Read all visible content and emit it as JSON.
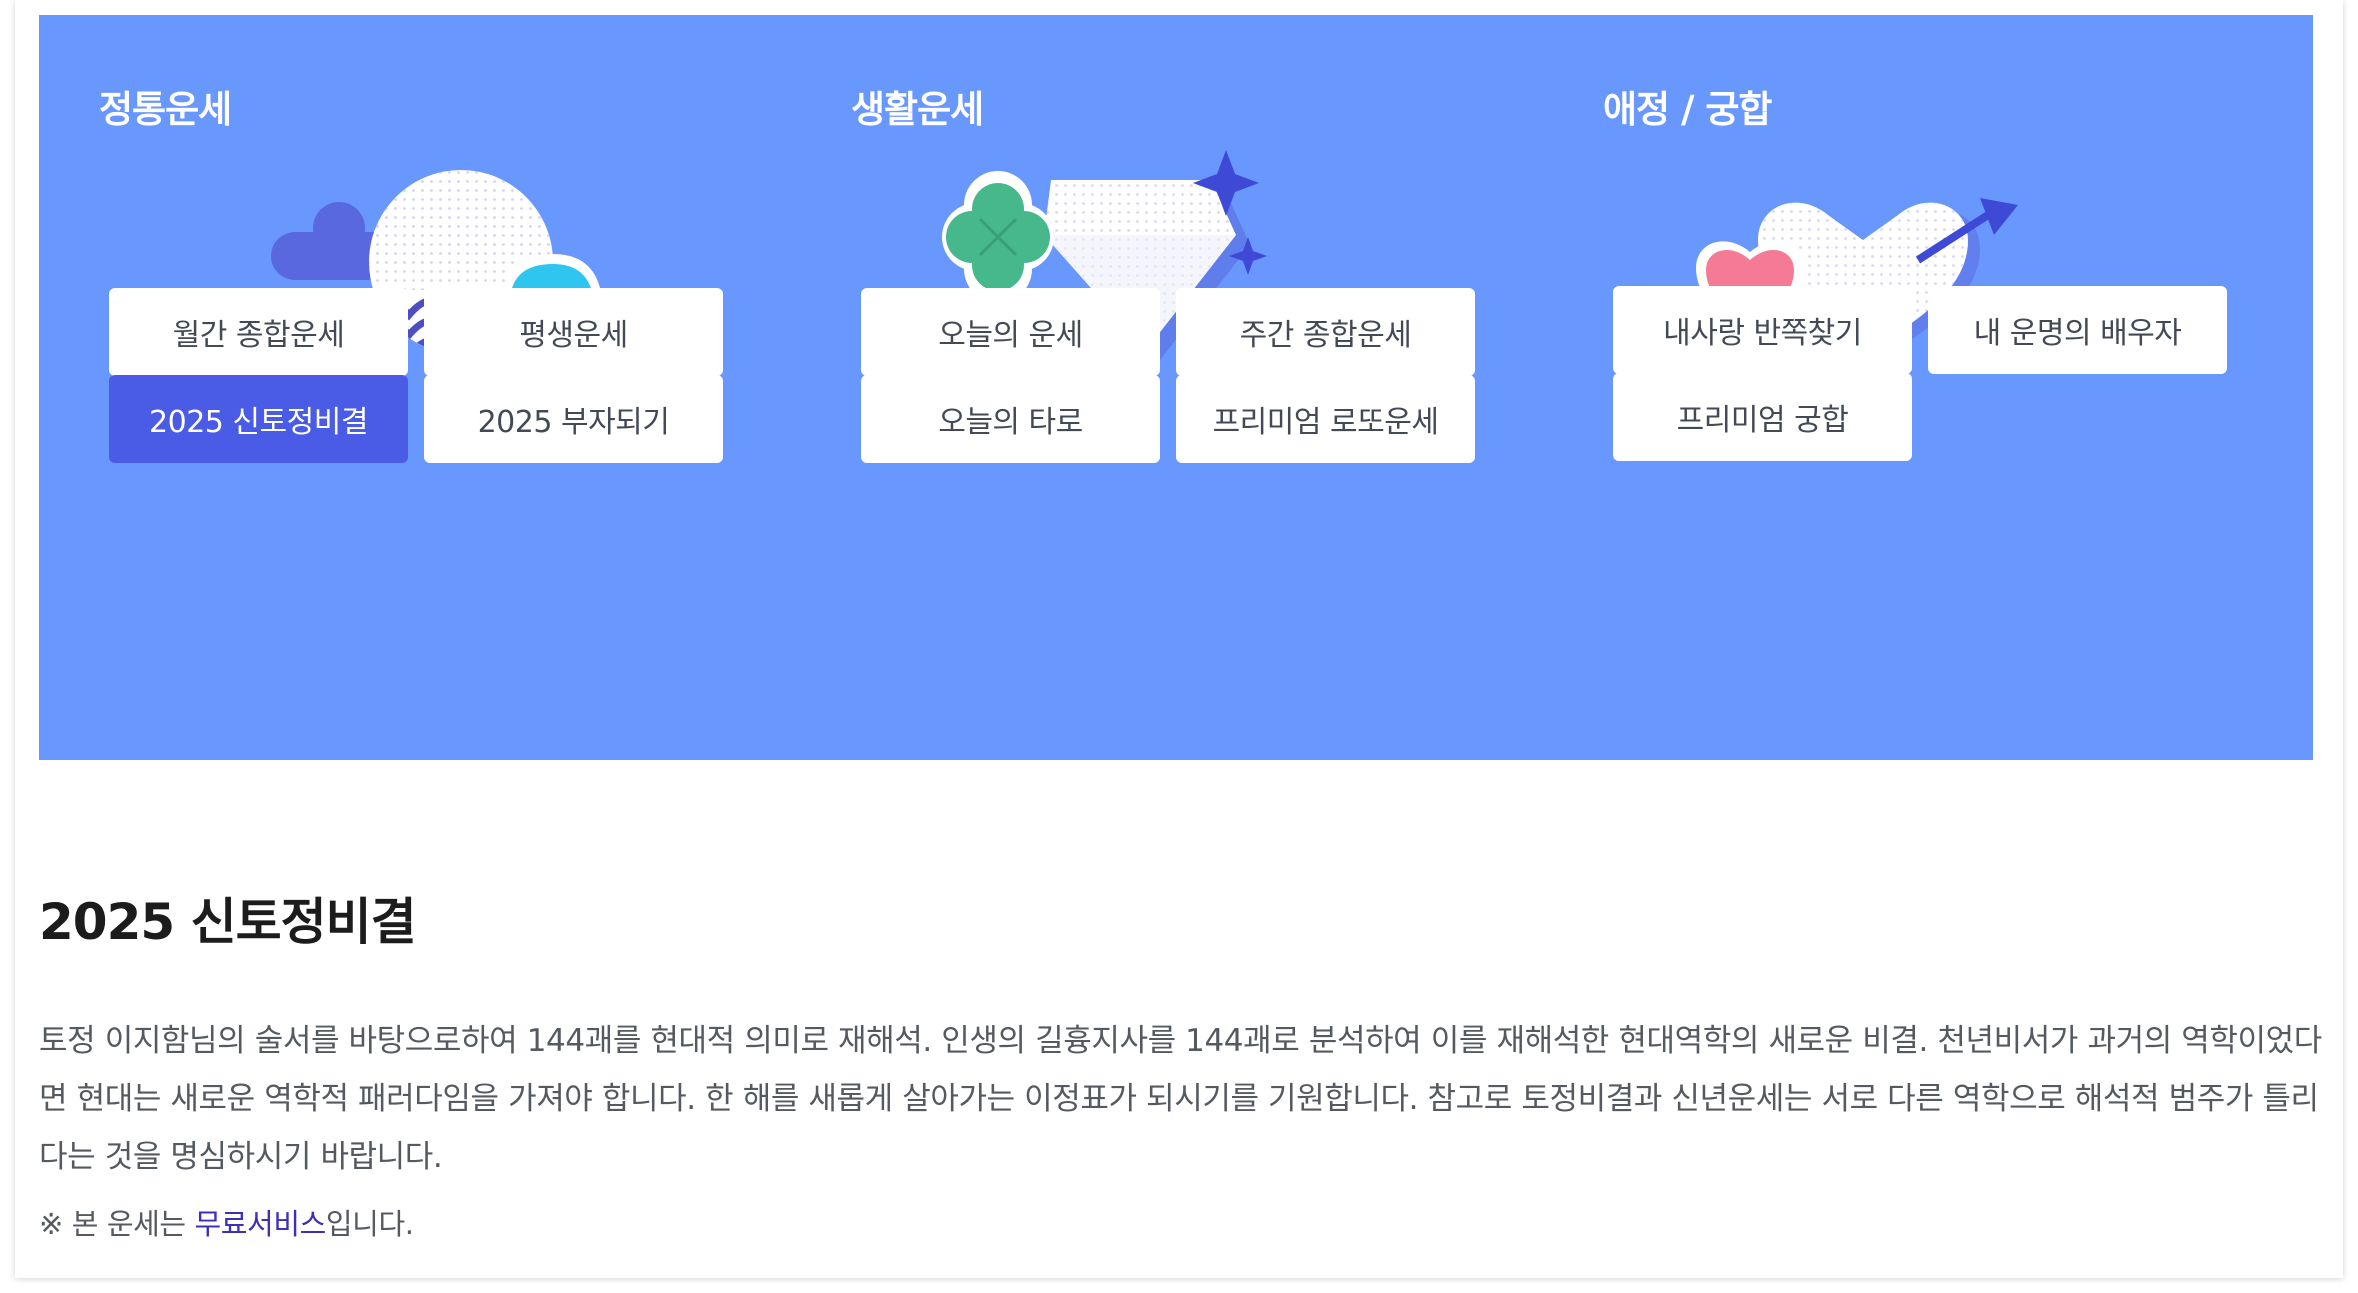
{
  "categories": [
    {
      "title": "정통운세",
      "icon": "moon-cloud-icon",
      "buttons": [
        {
          "label": "월간 종합운세",
          "active": false
        },
        {
          "label": "평생운세",
          "active": false
        },
        {
          "label": "2025 신토정비결",
          "active": true
        },
        {
          "label": "2025 부자되기",
          "active": false
        }
      ]
    },
    {
      "title": "생활운세",
      "icon": "clover-diamond-icon",
      "buttons": [
        {
          "label": "오늘의 운세",
          "active": false
        },
        {
          "label": "주간 종합운세",
          "active": false
        },
        {
          "label": "오늘의 타로",
          "active": false
        },
        {
          "label": "프리미엄 로또운세",
          "active": false
        }
      ]
    },
    {
      "title": "애정 / 궁합",
      "icon": "hearts-arrow-icon",
      "buttons": [
        {
          "label": "내사랑 반쪽찾기",
          "active": false
        },
        {
          "label": "내 운명의 배우자",
          "active": false
        },
        {
          "label": "프리미엄 궁합",
          "active": false
        }
      ]
    }
  ],
  "detail": {
    "title": "2025 신토정비결",
    "description": "토정 이지함님의 술서를 바탕으로하여 144괘를 현대적 의미로 재해석. 인생의 길흉지사를 144괘로 분석하여 이를 재해석한 현대역학의 새로운 비결. 천년비서가 과거의 역학이었다면 현대는 새로운 역학적 패러다임을 가져야 합니다. 한 해를 새롭게 살아가는 이정표가 되시기를 기원합니다. 참고로 토정비결과 신년운세는 서로 다른 역학으로 해석적 범주가 틀리다는 것을 명심하시기 바랍니다.",
    "note_prefix": "※ 본 운세는 ",
    "note_link": "무료서비스",
    "note_suffix": "입니다."
  },
  "colors": {
    "banner": "#6897fd",
    "active_button": "#4a5be6",
    "link": "#3d2fb8"
  }
}
